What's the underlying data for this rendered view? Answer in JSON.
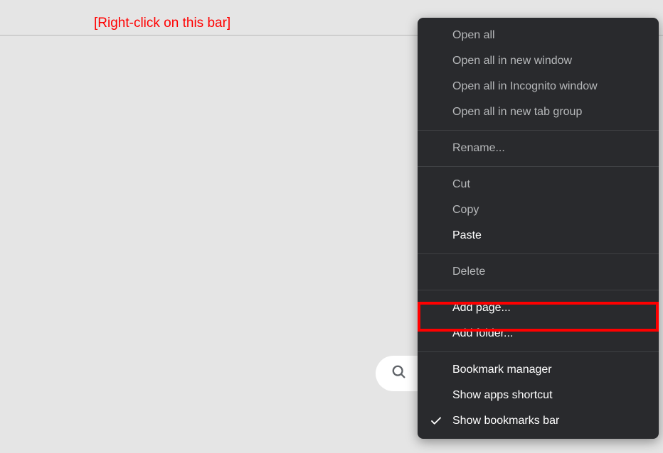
{
  "hint": "[Right-click on this bar]",
  "menu": {
    "group1": {
      "open_all": "Open all",
      "open_all_new_window": "Open all in new window",
      "open_all_incognito": "Open all in Incognito window",
      "open_all_tab_group": "Open all in new tab group"
    },
    "group2": {
      "rename": "Rename..."
    },
    "group3": {
      "cut": "Cut",
      "copy": "Copy",
      "paste": "Paste"
    },
    "group4": {
      "delete": "Delete"
    },
    "group5": {
      "add_page": "Add page...",
      "add_folder": "Add folder..."
    },
    "group6": {
      "bookmark_manager": "Bookmark manager",
      "show_apps_shortcut": "Show apps shortcut",
      "show_bookmarks_bar": "Show bookmarks bar"
    }
  },
  "highlight": {
    "target": "add_page"
  }
}
